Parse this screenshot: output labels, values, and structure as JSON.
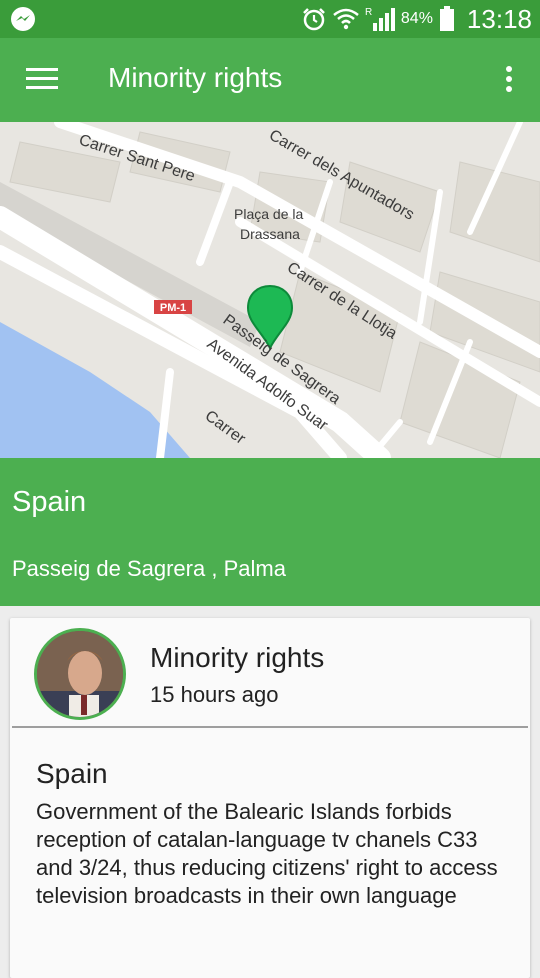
{
  "status_bar": {
    "battery_percent": "84%",
    "time": "13:18",
    "notification_icon": "messenger-icon",
    "indicators": [
      "alarm-icon",
      "wifi-icon",
      "signal-roaming-icon",
      "battery-icon"
    ]
  },
  "app_bar": {
    "title": "Minority rights",
    "menu_icon": "hamburger-menu-icon",
    "overflow_icon": "more-vert-icon"
  },
  "map": {
    "labels": {
      "street1": "Carrer Sant Pere",
      "street2": "Carrer dels Apuntadors",
      "place": "Plaça de la",
      "place2": "Drassana",
      "street3": "Carrer de la Llotja",
      "road_badge": "PM-1",
      "street4": "Passeig de Sagrera",
      "street5": "Avenida Adolfo Suar",
      "street6": "Carrer"
    },
    "colors": {
      "pin": "#1db954",
      "water": "#a1c2f2",
      "land": "#e8e6e1",
      "road": "#ffffff",
      "badge": "#d84444"
    }
  },
  "location": {
    "country": "Spain",
    "address": "Passeig de Sagrera , Palma"
  },
  "card": {
    "title": "Minority rights",
    "time_ago": "15 hours ago",
    "body_title": "Spain",
    "body_text": "Government of the Balearic Islands forbids reception of catalan-language tv chanels C33 and 3/24, thus reducing citizens' right to access television broadcasts in their own language"
  },
  "colors": {
    "status_bar": "#3a9c3a",
    "primary": "#4caf50",
    "background": "#ededed",
    "card": "#fafafa"
  }
}
